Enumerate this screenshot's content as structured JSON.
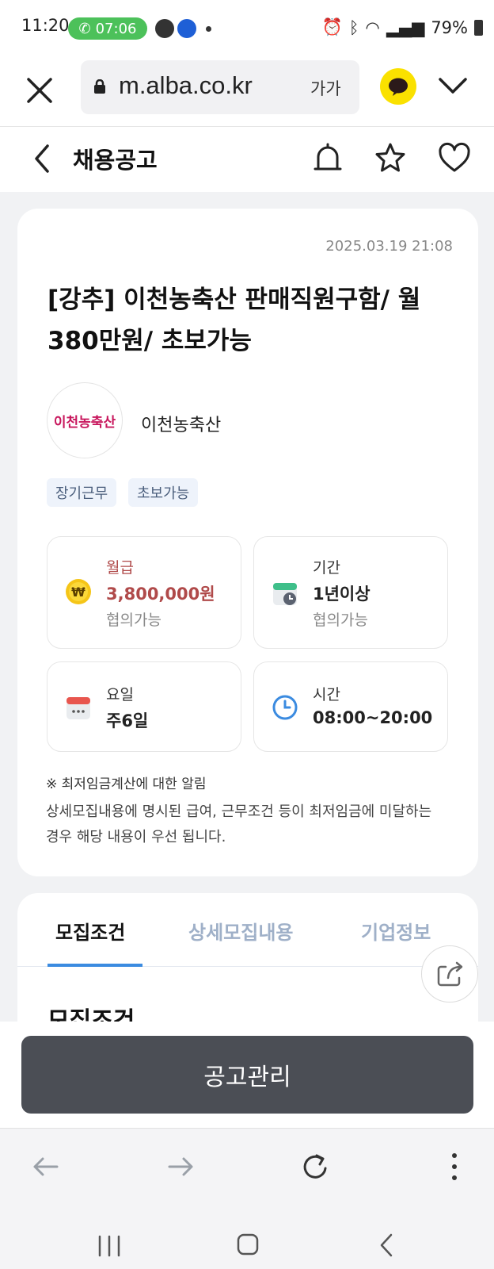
{
  "status_bar": {
    "time": "11:20",
    "call_timer": "07:06",
    "battery": "79%",
    "icons": [
      "phone-icon",
      "alarm-icon",
      "bluetooth-icon",
      "wifi-icon",
      "volte-icon",
      "signal-icon",
      "battery-icon"
    ]
  },
  "browser": {
    "url": "m.alba.co.kr",
    "text_size_label": "가가"
  },
  "header": {
    "title": "채용공고"
  },
  "job": {
    "posted_at": "2025.03.19 21:08",
    "title": "[강추] 이천농축산 판매직원구함/ 월 380만원/ 초보가능",
    "company_logo_text": "이천농축산",
    "company_name": "이천농축산",
    "tags": [
      "장기근무",
      "초보가능"
    ],
    "info": {
      "pay": {
        "label": "월급",
        "value": "3,800,000원",
        "sub": "협의가능"
      },
      "period": {
        "label": "기간",
        "value": "1년이상",
        "sub": "협의가능"
      },
      "days": {
        "label": "요일",
        "value": "주6일"
      },
      "hours": {
        "label": "시간",
        "value": "08:00~20:00"
      }
    },
    "notice_title": "※ 최저임금계산에 대한 알림",
    "notice_body": "상세모집내용에 명시된 급여, 근무조건 등이 최저임금에 미달하는 경우 해당 내용이 우선 됩니다."
  },
  "tabs": [
    {
      "label": "모집조건",
      "active": true
    },
    {
      "label": "상세모집내용",
      "active": false
    },
    {
      "label": "기업정보",
      "active": false
    }
  ],
  "section_title": "모집조건",
  "manage_button": "공고관리",
  "colors": {
    "pay_accent": "#b04a4a",
    "tab_active_indicator": "#3b8be0",
    "manage_button_bg": "#4b4e55",
    "kakao_yellow": "#fae100"
  }
}
